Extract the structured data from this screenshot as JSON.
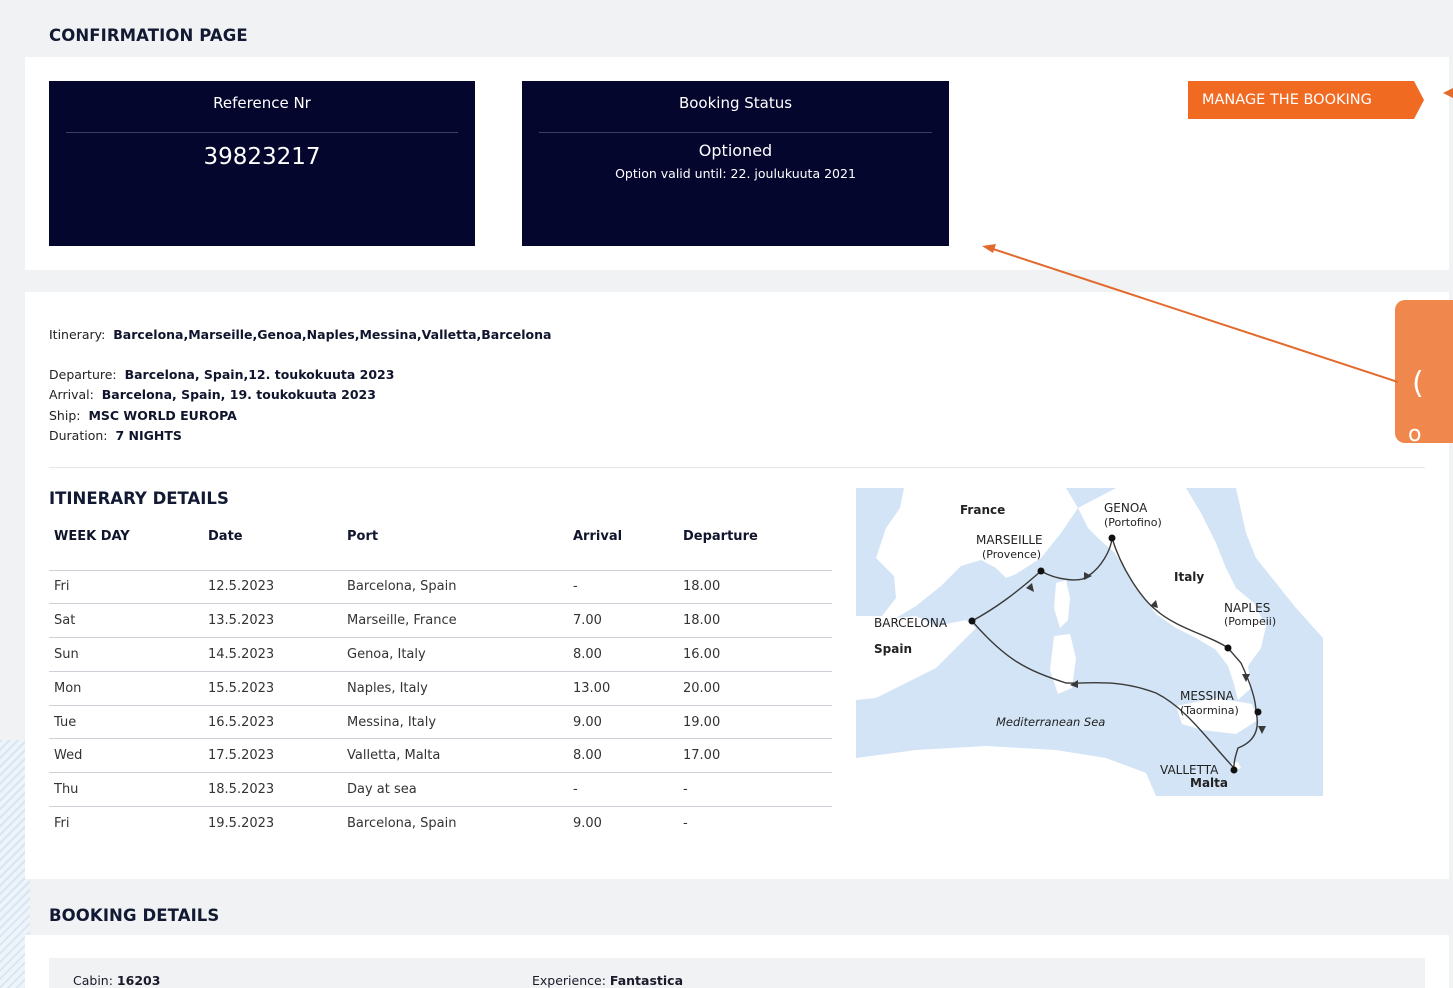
{
  "header": {
    "title": "CONFIRMATION PAGE"
  },
  "reference": {
    "label": "Reference Nr",
    "number": "39823217"
  },
  "status": {
    "label": "Booking Status",
    "value": "Optioned",
    "note": "Option valid until:  22. joulukuuta 2021"
  },
  "manage_button": {
    "label": "MANAGE THE BOOKING"
  },
  "cruise": {
    "itinerary_label": "Itinerary:",
    "itinerary_value": "Barcelona,Marseille,Genoa,Naples,Messina,Valletta,Barcelona",
    "departure_label": "Departure:",
    "departure_value": "Barcelona, Spain,12. toukokuuta 2023",
    "arrival_label": "Arrival:",
    "arrival_value": "Barcelona, Spain, 19. toukokuuta 2023",
    "ship_label": "Ship:",
    "ship_value": "MSC WORLD EUROPA",
    "duration_label": "Duration:",
    "duration_value": "7 NIGHTS"
  },
  "itinerary_details": {
    "title": "ITINERARY DETAILS",
    "columns": [
      "WEEK DAY",
      "Date",
      "Port",
      "Arrival",
      "Departure"
    ],
    "rows": [
      [
        "Fri",
        "12.5.2023",
        "Barcelona, Spain",
        "-",
        "18.00"
      ],
      [
        "Sat",
        "13.5.2023",
        "Marseille, France",
        "7.00",
        "18.00"
      ],
      [
        "Sun",
        "14.5.2023",
        "Genoa, Italy",
        "8.00",
        "16.00"
      ],
      [
        "Mon",
        "15.5.2023",
        "Naples, Italy",
        "13.00",
        "20.00"
      ],
      [
        "Tue",
        "16.5.2023",
        "Messina, Italy",
        "9.00",
        "19.00"
      ],
      [
        "Wed",
        "17.5.2023",
        "Valletta, Malta",
        "8.00",
        "17.00"
      ],
      [
        "Thu",
        "18.5.2023",
        "Day at sea",
        "-",
        "-"
      ],
      [
        "Fri",
        "19.5.2023",
        "Barcelona, Spain",
        "9.00",
        "-"
      ]
    ]
  },
  "map": {
    "labels": {
      "france": "France",
      "genoa": "GENOA",
      "portofino": "(Portofino)",
      "marseille": "MARSEILLE",
      "provence": "(Provence)",
      "italy": "Italy",
      "naples": "NAPLES",
      "pompeii": "(Pompeii)",
      "barcelona": "BARCELONA",
      "spain": "Spain",
      "messina": "MESSINA",
      "taormina": "(Taormina)",
      "sea": "Mediterranean Sea",
      "valletta": "VALLETTA",
      "malta": "Malta"
    }
  },
  "callout": {
    "line1": "(",
    "line2": "o"
  },
  "booking_details": {
    "title": "BOOKING DETAILS",
    "cabin_label": "Cabin:",
    "cabin_value": "16203",
    "experience_label": "Experience:",
    "experience_value": "Fantastica"
  },
  "colors": {
    "dark_box": "#04062e",
    "accent_orange": "#f16a22",
    "callout_orange": "#f0884d",
    "map_sea": "#d2e4f5",
    "map_land": "#ffffff"
  }
}
